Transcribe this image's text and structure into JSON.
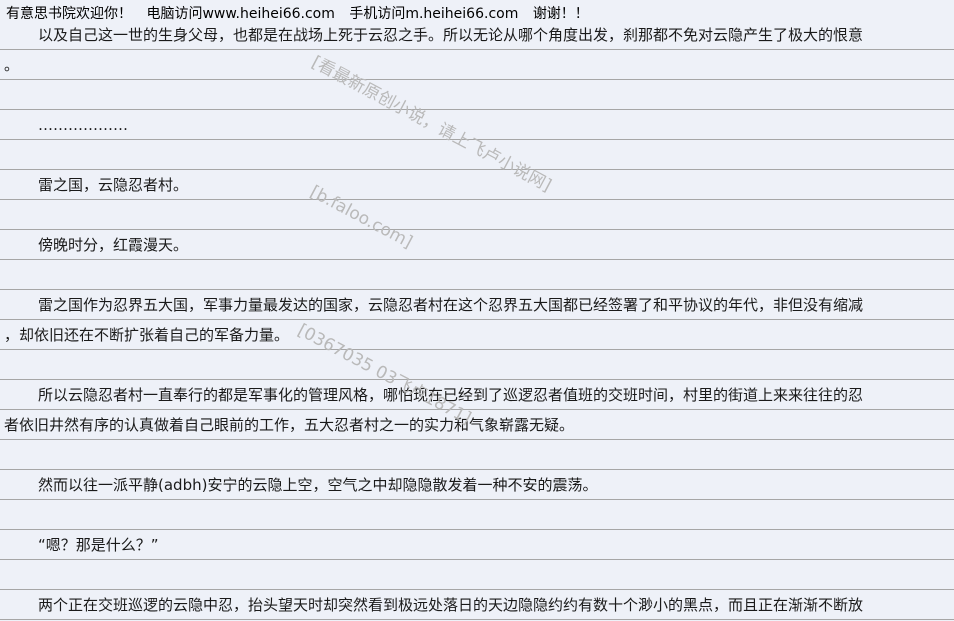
{
  "header": {
    "welcome": "有意思书院欢迎你！",
    "pc": "电脑访问www.heihei66.com",
    "mobile": "手机访问m.heihei66.com",
    "thanks": "谢谢！！"
  },
  "lines": [
    "以及自己这一世的生身父母，也都是在战场上死于云忍之手。所以无论从哪个角度出发，刹那都不免对云隐产生了极大的恨意",
    "。",
    "………………",
    "雷之国，云隐忍者村。",
    "傍晚时分，红霞漫天。",
    "雷之国作为忍界五大国，军事力量最发达的国家，云隐忍者村在这个忍界五大国都已经签署了和平协议的年代，非但没有缩减",
    "，却依旧还在不断扩张着自己的军备力量。",
    "所以云隐忍者村一直奉行的都是军事化的管理风格，哪怕现在已经到了巡逻忍者值班的交班时间，村里的街道上来来往往的忍",
    "者依旧井然有序的认真做着自己眼前的工作，五大忍者村之一的实力和气象崭露无疑。",
    "然而以往一派平静(adbh)安宁的云隐上空，空气之中却隐隐散发着一种不安的震荡。",
    "“嗯？那是什么？”",
    "两个正在交班巡逻的云隐中忍，抬头望天时却突然看到极远处落日的天边隐隐约约有数十个渺小的黑点，而且正在渐渐不断放"
  ],
  "watermarks": [
    "[看最新原创小说，请上飞卢小说网]",
    "[b.faloo.com]",
    "[0367035 03飞卢1871]"
  ]
}
